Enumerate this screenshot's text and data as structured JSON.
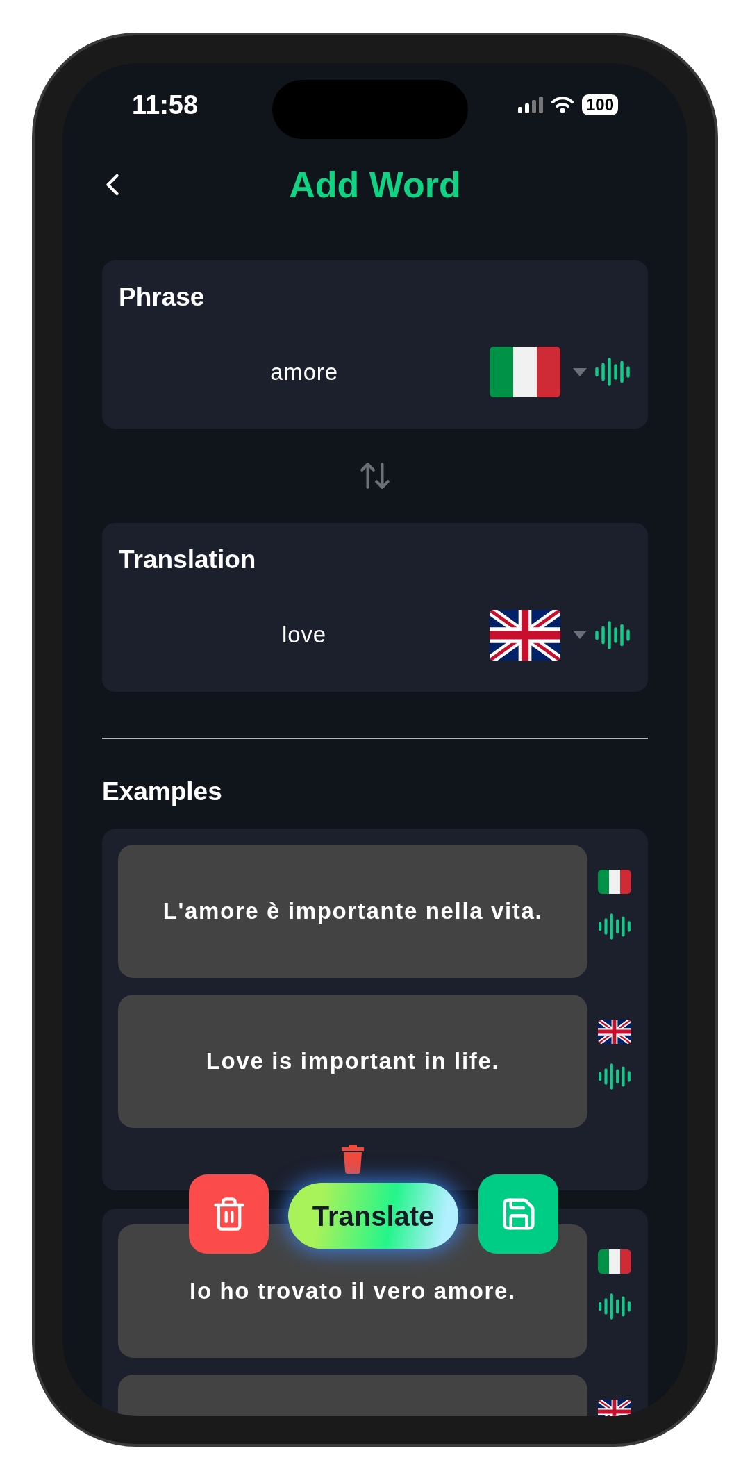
{
  "status_bar": {
    "time": "11:58",
    "battery": "100"
  },
  "header": {
    "title": "Add Word"
  },
  "phrase": {
    "label": "Phrase",
    "value": "amore",
    "kind": "italian"
  },
  "translation": {
    "label": "Translation",
    "value": "love",
    "kind": "british"
  },
  "examples": {
    "title": "Examples",
    "groups": [
      {
        "sentences": [
          {
            "text": "L'amore è importante nella vita.",
            "kind": "italian"
          },
          {
            "text": "Love is important in life.",
            "kind": "british"
          }
        ]
      },
      {
        "sentences": [
          {
            "text": "Io ho trovato il vero amore.",
            "kind": "italian"
          },
          {
            "kind": "british"
          }
        ]
      }
    ]
  },
  "actions": {
    "translate": "Translate"
  }
}
